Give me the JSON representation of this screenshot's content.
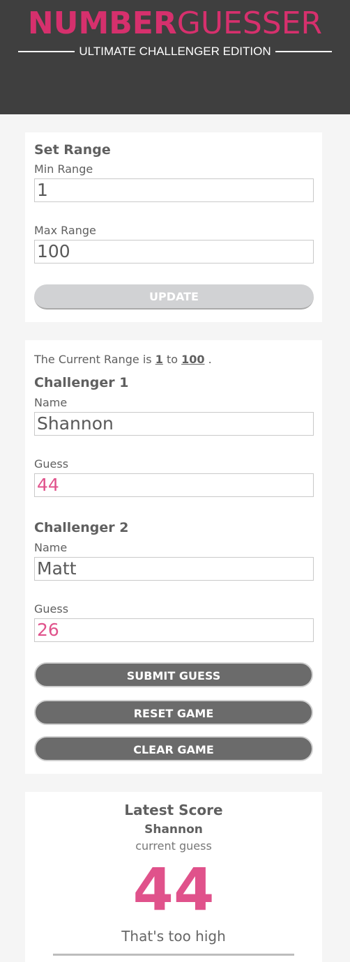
{
  "header": {
    "logo_bold": "NUMBER",
    "logo_light": "GUESSER",
    "subtitle": "ULTIMATE CHALLENGER EDITION"
  },
  "set_range": {
    "title": "Set Range",
    "min_label": "Min Range",
    "min_value": "1",
    "max_label": "Max Range",
    "max_value": "100",
    "update_label": "UPDATE"
  },
  "challengers": {
    "range_prefix": "The Current Range is",
    "range_min": "1",
    "range_to": "to",
    "range_max": "100",
    "range_suffix": ".",
    "c1": {
      "title": "Challenger 1",
      "name_label": "Name",
      "name_value": "Shannon",
      "guess_label": "Guess",
      "guess_value": "44"
    },
    "c2": {
      "title": "Challenger 2",
      "name_label": "Name",
      "name_value": "Matt",
      "guess_label": "Guess",
      "guess_value": "26"
    },
    "submit_label": "SUBMIT GUESS",
    "reset_label": "RESET GAME",
    "clear_label": "CLEAR GAME"
  },
  "latest_score": {
    "title": "Latest Score",
    "player": "Shannon",
    "caption": "current guess",
    "number": "44",
    "feedback": "That's too high"
  },
  "colors": {
    "accent": "#d6306d",
    "header_bg": "#3f3f3f",
    "dark_button": "#6b6b6b",
    "light_button": "#d1d2d4"
  }
}
